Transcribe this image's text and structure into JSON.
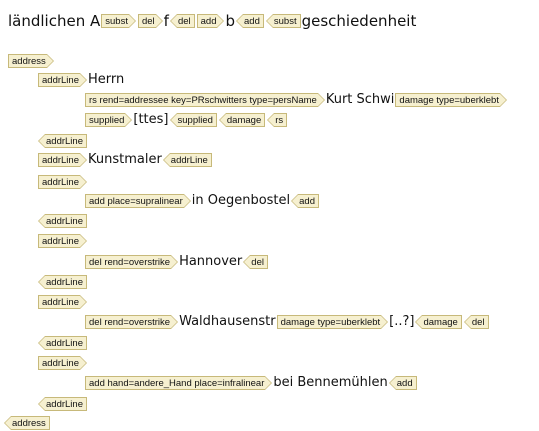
{
  "header": {
    "t1": "ländlichen A",
    "subst_open": "subst",
    "del_open": "del",
    "t2": "f",
    "del_close": "del",
    "add_open": "add",
    "t3": "b",
    "add_close": "add",
    "subst_close": "subst",
    "t4": "geschiedenheit"
  },
  "lines": {
    "address_open": "address",
    "addr1_open": "addrLine",
    "herrn": "Herrn",
    "rs_open": "rs rend=addressee key=PRschwitters type=persName",
    "kurt": "Kurt Schwi",
    "damage_open": "damage type=uberklebt",
    "supplied_open": "supplied",
    "ttes": "[ttes]",
    "supplied_close": "supplied",
    "damage_close": "damage",
    "rs_close": "rs",
    "addr1_close": "addrLine",
    "addr2_open": "addrLine",
    "kunstmaler": "Kunstmaler",
    "addr2_close": "addrLine",
    "addr3_open": "addrLine",
    "add_supra_open": "add place=supralinear",
    "oegenbostel": "in Oegenbostel",
    "add_supra_close": "add",
    "addr3_close": "addrLine",
    "addr4_open": "addrLine",
    "del1_open": "del rend=overstrike",
    "hannover": "Hannover",
    "del1_close": "del",
    "addr4_close": "addrLine",
    "addr5_open": "addrLine",
    "del2_open": "del rend=overstrike",
    "waldhausen": "Waldhausenstr",
    "damage2_open": "damage type=uberklebt",
    "unclear": "[..?]",
    "damage2_close": "damage",
    "del2_close": "del",
    "addr5_close": "addrLine",
    "addr6_open": "addrLine",
    "add_infra_open": "add hand=andere_Hand place=infralinear",
    "benne": "bei Bennemühlen",
    "add_infra_close": "add",
    "addr6_close": "addrLine",
    "address_close": "address"
  }
}
